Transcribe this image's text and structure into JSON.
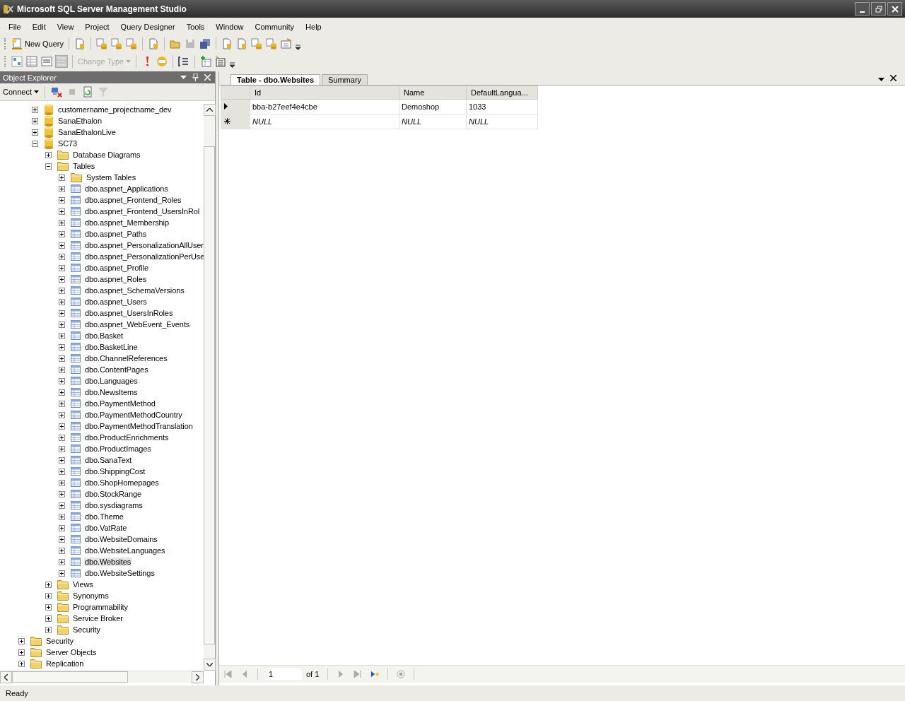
{
  "window": {
    "title": "Microsoft SQL Server Management Studio"
  },
  "menu": [
    "File",
    "Edit",
    "View",
    "Project",
    "Query Designer",
    "Tools",
    "Window",
    "Community",
    "Help"
  ],
  "toolbar1": [
    {
      "kind": "newquery",
      "label": "New Query"
    },
    {
      "kind": "sep"
    },
    {
      "kind": "page"
    },
    {
      "kind": "sep"
    },
    {
      "kind": "mdx"
    },
    {
      "kind": "dmx"
    },
    {
      "kind": "xmla"
    },
    {
      "kind": "sep"
    },
    {
      "kind": "page"
    },
    {
      "kind": "sep"
    },
    {
      "kind": "open"
    },
    {
      "kind": "save"
    },
    {
      "kind": "saveall"
    },
    {
      "kind": "sep"
    },
    {
      "kind": "page"
    },
    {
      "kind": "page"
    },
    {
      "kind": "db"
    },
    {
      "kind": "db"
    },
    {
      "kind": "props"
    },
    {
      "kind": "more"
    }
  ],
  "toolbar2": [
    {
      "kind": "diagram"
    },
    {
      "kind": "grid"
    },
    {
      "kind": "sql"
    },
    {
      "kind": "results"
    },
    {
      "kind": "sep"
    },
    {
      "kind": "changetype",
      "label": "Change Type"
    },
    {
      "kind": "sep"
    },
    {
      "kind": "exclaim"
    },
    {
      "kind": "sqlverify"
    },
    {
      "kind": "sep"
    },
    {
      "kind": "list"
    },
    {
      "kind": "sep"
    },
    {
      "kind": "addtable"
    },
    {
      "kind": "addgroup"
    },
    {
      "kind": "more"
    }
  ],
  "object_explorer": {
    "title": "Object Explorer",
    "connect": "Connect",
    "tree": [
      {
        "children": [
          {
            "children": [
              {
                "label": "customername_projectname_dev",
                "kind": "database",
                "expanded": false,
                "selected": false
              },
              {
                "label": "SanaEthalon",
                "kind": "database",
                "expanded": false,
                "selected": false
              },
              {
                "label": "SanaEthalonLive",
                "kind": "database",
                "expanded": false,
                "selected": false
              },
              {
                "label": "SC73",
                "kind": "database",
                "expanded": true,
                "selected": false,
                "children": [
                  {
                    "label": "Database Diagrams",
                    "kind": "folder",
                    "expanded": false,
                    "selected": false
                  },
                  {
                    "label": "Tables",
                    "kind": "folder",
                    "expanded": true,
                    "selected": false,
                    "children": [
                      {
                        "label": "System Tables",
                        "kind": "folder",
                        "expanded": false,
                        "selected": false
                      },
                      {
                        "label": "dbo.aspnet_Applications",
                        "kind": "table",
                        "expanded": false,
                        "selected": false
                      },
                      {
                        "label": "dbo.aspnet_Frontend_Roles",
                        "kind": "table",
                        "expanded": false,
                        "selected": false
                      },
                      {
                        "label": "dbo.aspnet_Frontend_UsersInRol",
                        "kind": "table",
                        "expanded": false,
                        "selected": false
                      },
                      {
                        "label": "dbo.aspnet_Membership",
                        "kind": "table",
                        "expanded": false,
                        "selected": false
                      },
                      {
                        "label": "dbo.aspnet_Paths",
                        "kind": "table",
                        "expanded": false,
                        "selected": false
                      },
                      {
                        "label": "dbo.aspnet_PersonalizationAllUser",
                        "kind": "table",
                        "expanded": false,
                        "selected": false
                      },
                      {
                        "label": "dbo.aspnet_PersonalizationPerUse",
                        "kind": "table",
                        "expanded": false,
                        "selected": false
                      },
                      {
                        "label": "dbo.aspnet_Profile",
                        "kind": "table",
                        "expanded": false,
                        "selected": false
                      },
                      {
                        "label": "dbo.aspnet_Roles",
                        "kind": "table",
                        "expanded": false,
                        "selected": false
                      },
                      {
                        "label": "dbo.aspnet_SchemaVersions",
                        "kind": "table",
                        "expanded": false,
                        "selected": false
                      },
                      {
                        "label": "dbo.aspnet_Users",
                        "kind": "table",
                        "expanded": false,
                        "selected": false
                      },
                      {
                        "label": "dbo.aspnet_UsersInRoles",
                        "kind": "table",
                        "expanded": false,
                        "selected": false
                      },
                      {
                        "label": "dbo.aspnet_WebEvent_Events",
                        "kind": "table",
                        "expanded": false,
                        "selected": false
                      },
                      {
                        "label": "dbo.Basket",
                        "kind": "table",
                        "expanded": false,
                        "selected": false
                      },
                      {
                        "label": "dbo.BasketLine",
                        "kind": "table",
                        "expanded": false,
                        "selected": false
                      },
                      {
                        "label": "dbo.ChannelReferences",
                        "kind": "table",
                        "expanded": false,
                        "selected": false
                      },
                      {
                        "label": "dbo.ContentPages",
                        "kind": "table",
                        "expanded": false,
                        "selected": false
                      },
                      {
                        "label": "dbo.Languages",
                        "kind": "table",
                        "expanded": false,
                        "selected": false
                      },
                      {
                        "label": "dbo.NewsItems",
                        "kind": "table",
                        "expanded": false,
                        "selected": false
                      },
                      {
                        "label": "dbo.PaymentMethod",
                        "kind": "table",
                        "expanded": false,
                        "selected": false
                      },
                      {
                        "label": "dbo.PaymentMethodCountry",
                        "kind": "table",
                        "expanded": false,
                        "selected": false
                      },
                      {
                        "label": "dbo.PaymentMethodTranslation",
                        "kind": "table",
                        "expanded": false,
                        "selected": false
                      },
                      {
                        "label": "dbo.ProductEnrichments",
                        "kind": "table",
                        "expanded": false,
                        "selected": false
                      },
                      {
                        "label": "dbo.ProductImages",
                        "kind": "table",
                        "expanded": false,
                        "selected": false
                      },
                      {
                        "label": "dbo.SanaText",
                        "kind": "table",
                        "expanded": false,
                        "selected": false
                      },
                      {
                        "label": "dbo.ShippingCost",
                        "kind": "table",
                        "expanded": false,
                        "selected": false
                      },
                      {
                        "label": "dbo.ShopHomepages",
                        "kind": "table",
                        "expanded": false,
                        "selected": false
                      },
                      {
                        "label": "dbo.StockRange",
                        "kind": "table",
                        "expanded": false,
                        "selected": false
                      },
                      {
                        "label": "dbo.sysdiagrams",
                        "kind": "table",
                        "expanded": false,
                        "selected": false
                      },
                      {
                        "label": "dbo.Theme",
                        "kind": "table",
                        "expanded": false,
                        "selected": false
                      },
                      {
                        "label": "dbo.VatRate",
                        "kind": "table",
                        "expanded": false,
                        "selected": false
                      },
                      {
                        "label": "dbo.WebsiteDomains",
                        "kind": "table",
                        "expanded": false,
                        "selected": false
                      },
                      {
                        "label": "dbo.WebsiteLanguages",
                        "kind": "table",
                        "expanded": false,
                        "selected": false
                      },
                      {
                        "label": "dbo.Websites",
                        "kind": "table",
                        "expanded": false,
                        "selected": true
                      },
                      {
                        "label": "dbo.WebsiteSettings",
                        "kind": "table",
                        "expanded": false,
                        "selected": false
                      }
                    ]
                  },
                  {
                    "label": "Views",
                    "kind": "folder",
                    "expanded": false,
                    "selected": false
                  },
                  {
                    "label": "Synonyms",
                    "kind": "folder",
                    "expanded": false,
                    "selected": false
                  },
                  {
                    "label": "Programmability",
                    "kind": "folder",
                    "expanded": false,
                    "selected": false
                  },
                  {
                    "label": "Service Broker",
                    "kind": "folder",
                    "expanded": false,
                    "selected": false
                  },
                  {
                    "label": "Security",
                    "kind": "folder",
                    "expanded": false,
                    "selected": false
                  }
                ]
              }
            ]
          },
          {
            "label": "Security",
            "kind": "folder",
            "expanded": false,
            "selected": false
          },
          {
            "label": "Server Objects",
            "kind": "folder",
            "expanded": false,
            "selected": false
          },
          {
            "label": "Replication",
            "kind": "folder",
            "expanded": false,
            "selected": false
          }
        ]
      }
    ]
  },
  "document_tabs": [
    {
      "label": "Table - dbo.Websites",
      "selected": true
    },
    {
      "label": "Summary",
      "selected": false
    }
  ],
  "table": {
    "columns": [
      "Id",
      "Name",
      "DefaultLangua..."
    ],
    "rows": [
      {
        "kind": "current",
        "cells": [
          "bba-b27eef4e4cbe",
          "Demoshop",
          "1033"
        ]
      },
      {
        "kind": "new",
        "cells": [
          "NULL",
          "NULL",
          "NULL"
        ]
      }
    ]
  },
  "pager": {
    "value": "1",
    "of": "of 1"
  },
  "status_bar": "Ready"
}
